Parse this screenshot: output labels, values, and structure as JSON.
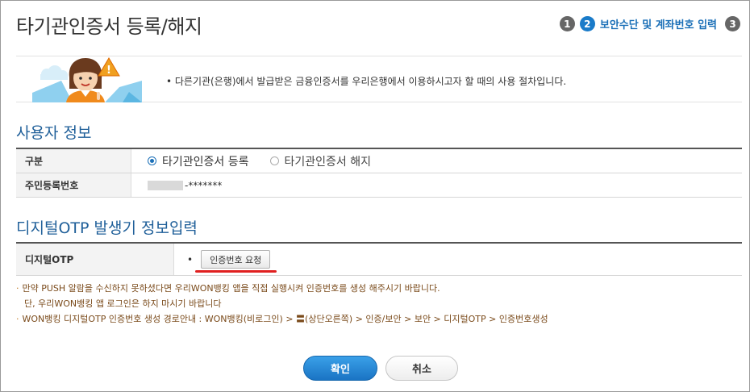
{
  "header": {
    "title": "타기관인증서 등록/해지"
  },
  "steps": [
    {
      "num": "1",
      "label": ""
    },
    {
      "num": "2",
      "label": "보안수단 및 계좌번호 입력"
    },
    {
      "num": "3",
      "label": ""
    }
  ],
  "notice": {
    "text": "• 다른기관(은행)에서 발급받은 금융인증서를 우리은행에서 이용하시고자 할 때의 사용 절차입니다."
  },
  "user_info": {
    "section_title": "사용자 정보",
    "type_label": "구분",
    "option_register": "타기관인증서 등록",
    "option_cancel": "타기관인증서 해지",
    "ssn_label": "주민등록번호",
    "ssn_back": "-*******"
  },
  "otp": {
    "section_title": "디지털OTP 발생기 정보입력",
    "label": "디지털OTP",
    "bullet": "•",
    "request_button": "인증번호 요청"
  },
  "notes": {
    "line1": "만약 PUSH 알람을 수신하지 못하셨다면 우리WON뱅킹 앱을 직접 실행시켜 인증번호를 생성 해주시기 바랍니다.",
    "line2": "단, 우리WON뱅킹 앱 로그인은 하지 마시기 바랍니다",
    "line3": "WON뱅킹 디지털OTP 인증번호 생성 경로안내 : WON뱅킹(비로그인) > 〓(상단오른쪽) > 인증/보안 > 보안 > 디지털OTP > 인증번호생성"
  },
  "buttons": {
    "confirm": "확인",
    "cancel": "취소"
  },
  "colors": {
    "accent": "#1a74c4",
    "section_title": "#1f5f99",
    "note_text": "#7a4a1a",
    "highlight_underline": "#e02020"
  }
}
